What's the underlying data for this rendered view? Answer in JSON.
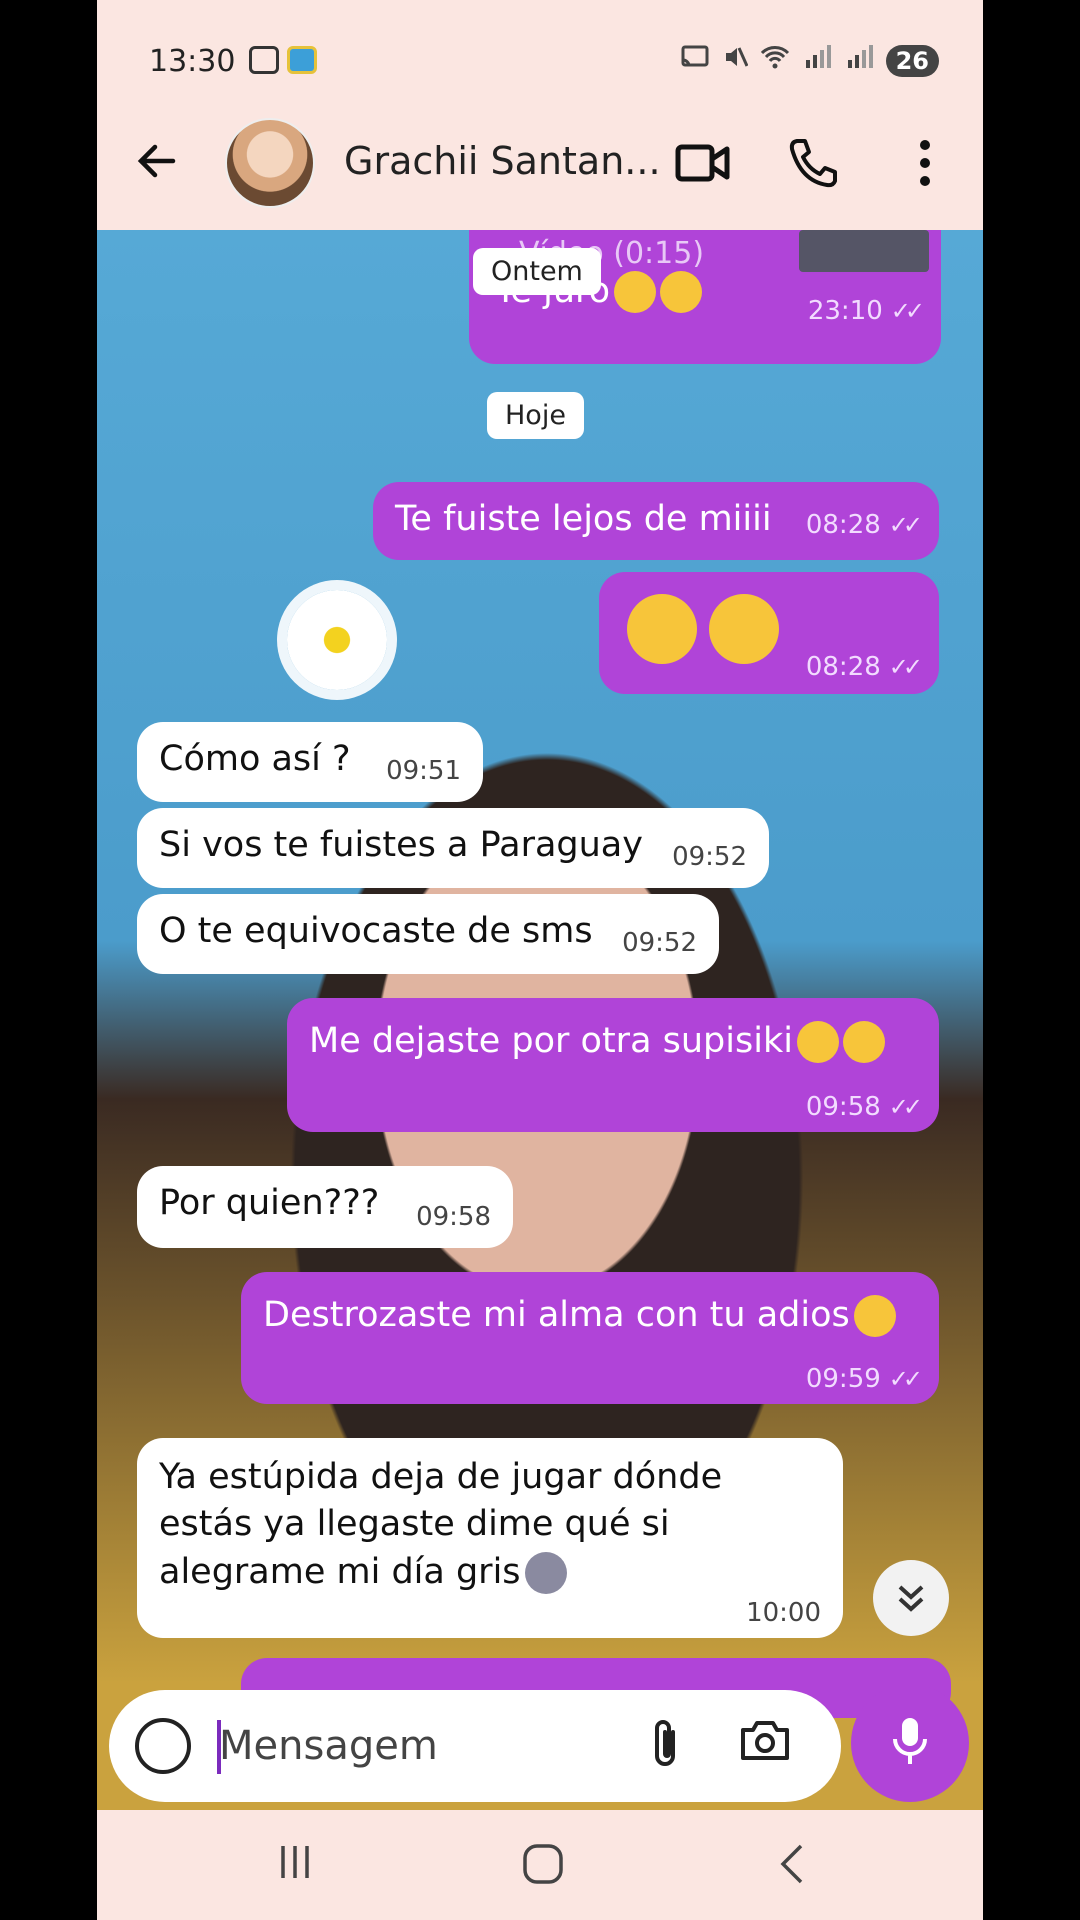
{
  "status_bar": {
    "time": "13:30",
    "battery": "26"
  },
  "header": {
    "contact_name": "Grachii Santan..."
  },
  "chat": {
    "partial_message": {
      "text": "Te juro",
      "time": "23:10",
      "video_label": "Vídeo (0:15)"
    },
    "date_yesterday": "Ontem",
    "date_today": "Hoje",
    "messages": [
      {
        "dir": "out",
        "text": "Te fuiste lejos de miiii",
        "time": "08:28"
      },
      {
        "dir": "out",
        "text": "",
        "time": "08:28"
      },
      {
        "dir": "in",
        "text": "Cómo así ?",
        "time": "09:51"
      },
      {
        "dir": "in",
        "text": "Si vos te fuistes a Paraguay",
        "time": "09:52"
      },
      {
        "dir": "in",
        "text": "O te equivocaste de sms",
        "time": "09:52"
      },
      {
        "dir": "out",
        "text": "Me dejaste por otra supisiki",
        "time": "09:58"
      },
      {
        "dir": "in",
        "text": "Por quien???",
        "time": "09:58"
      },
      {
        "dir": "out",
        "text": "Destrozaste mi alma con tu adios",
        "time": "09:59"
      },
      {
        "dir": "in",
        "text_lines": [
          "Ya estúpida deja de jugar dónde",
          "estás ya llegaste dime qué si",
          "alegrame mi día gris"
        ],
        "time": "10:00"
      }
    ],
    "read_ticks": "✓✓"
  },
  "input": {
    "placeholder": "Mensagem"
  },
  "colors": {
    "outgoing": "#b044d8",
    "incoming": "#ffffff",
    "header_bg": "#fbe6e1"
  },
  "icons": [
    "back-arrow-icon",
    "video-call-icon",
    "phone-icon",
    "more-icon",
    "emoji-icon",
    "attach-icon",
    "camera-icon",
    "mic-icon",
    "scroll-down-icon",
    "recents-icon",
    "home-icon",
    "back-nav-icon"
  ]
}
